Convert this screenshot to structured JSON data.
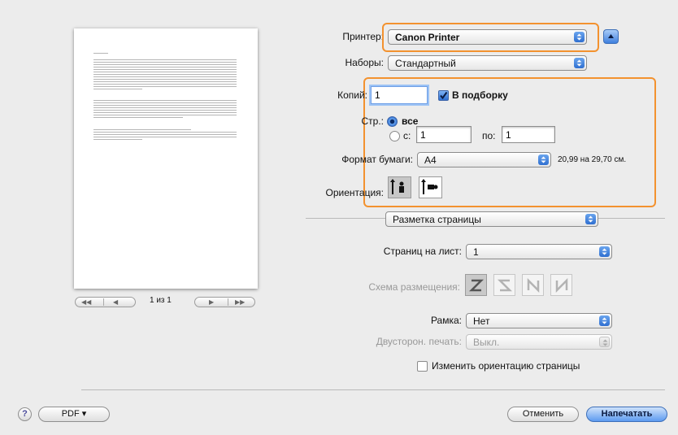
{
  "printer": {
    "label": "Принтер:",
    "value": "Canon Printer"
  },
  "presets": {
    "label": "Наборы:",
    "value": "Стандартный"
  },
  "copies": {
    "label": "Копий:",
    "value": "1",
    "collate_label": "В подборку",
    "collate_checked": true
  },
  "pages": {
    "label": "Стр.:",
    "all_label": "все",
    "from_label": "с:",
    "from_value": "1",
    "to_label": "по:",
    "to_value": "1",
    "selected": "all"
  },
  "paper_size": {
    "label": "Формат бумаги:",
    "value": "A4",
    "dimensions": "20,99 на 29,70 см."
  },
  "orientation": {
    "label": "Ориентация:"
  },
  "section": {
    "value": "Разметка страницы"
  },
  "pages_per_sheet": {
    "label": "Страниц на лист:",
    "value": "1"
  },
  "layout_direction": {
    "label": "Схема размещения:"
  },
  "border": {
    "label": "Рамка:",
    "value": "Нет"
  },
  "two_sided": {
    "label": "Двусторон. печать:",
    "value": "Выкл."
  },
  "reverse_orientation": {
    "label": "Изменить ориентацию страницы",
    "checked": false
  },
  "preview": {
    "page_counter": "1 из 1"
  },
  "footer": {
    "help": "?",
    "pdf_label": "PDF ▾",
    "cancel_label": "Отменить",
    "print_label": "Напечатать"
  },
  "colors": {
    "highlight": "#f3922f",
    "accent": "#2f6fd0"
  }
}
